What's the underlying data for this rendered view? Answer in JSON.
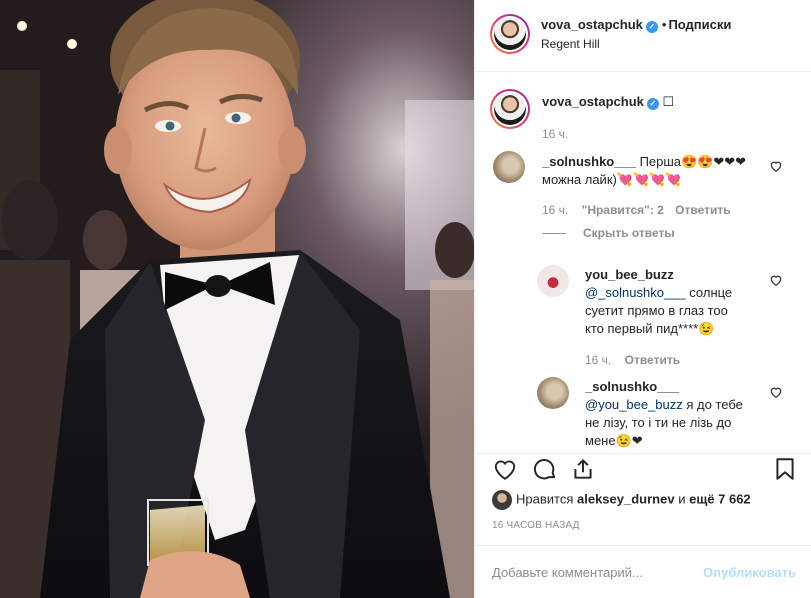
{
  "post": {
    "author": "vova_ostapchuk",
    "separator": "•",
    "follow_label": "Подписки",
    "location": "Regent Hill"
  },
  "caption": {
    "author": "vova_ostapchuk",
    "text": "☐",
    "time": "16 ч."
  },
  "comments": [
    {
      "author": "_solnushko___",
      "text_line1": "Перша😍😍❤❤❤",
      "text_line2": "можна лайк)💘💘💘💘",
      "time": "16 ч.",
      "likes": "\"Нравится\": 2",
      "reply": "Ответить",
      "hide_replies": "Скрыть ответы"
    }
  ],
  "replies": [
    {
      "author": "you_bee_buzz",
      "mention": "@_solnushko___",
      "text_line1": " солнце",
      "text_line2": "суетит прямо в глаз тоо",
      "text_line3": "кто первый пид****😉",
      "time": "16 ч.",
      "reply": "Ответить"
    },
    {
      "author": "_solnushko___",
      "mention": "@you_bee_buzz",
      "text_line1": " я до тебе",
      "text_line2": "не лізу, то і ти не лізь до",
      "text_line3": "мене😉❤"
    }
  ],
  "likes": {
    "prefix": "Нравится",
    "user": "aleksey_durnev",
    "and": "и",
    "others": "ещё 7 662"
  },
  "time_ago": "16 ЧАСОВ НАЗАД",
  "add_comment": {
    "placeholder": "Добавьте комментарий...",
    "publish": "Опубликовать"
  },
  "colors": {
    "verified": "#3897f0",
    "mention": "#003569",
    "publish_disabled": "#b2dffc",
    "muted": "#8e8e8e"
  },
  "icons": [
    "verified-badge-icon",
    "heart-icon",
    "comment-icon",
    "share-icon",
    "bookmark-icon"
  ]
}
